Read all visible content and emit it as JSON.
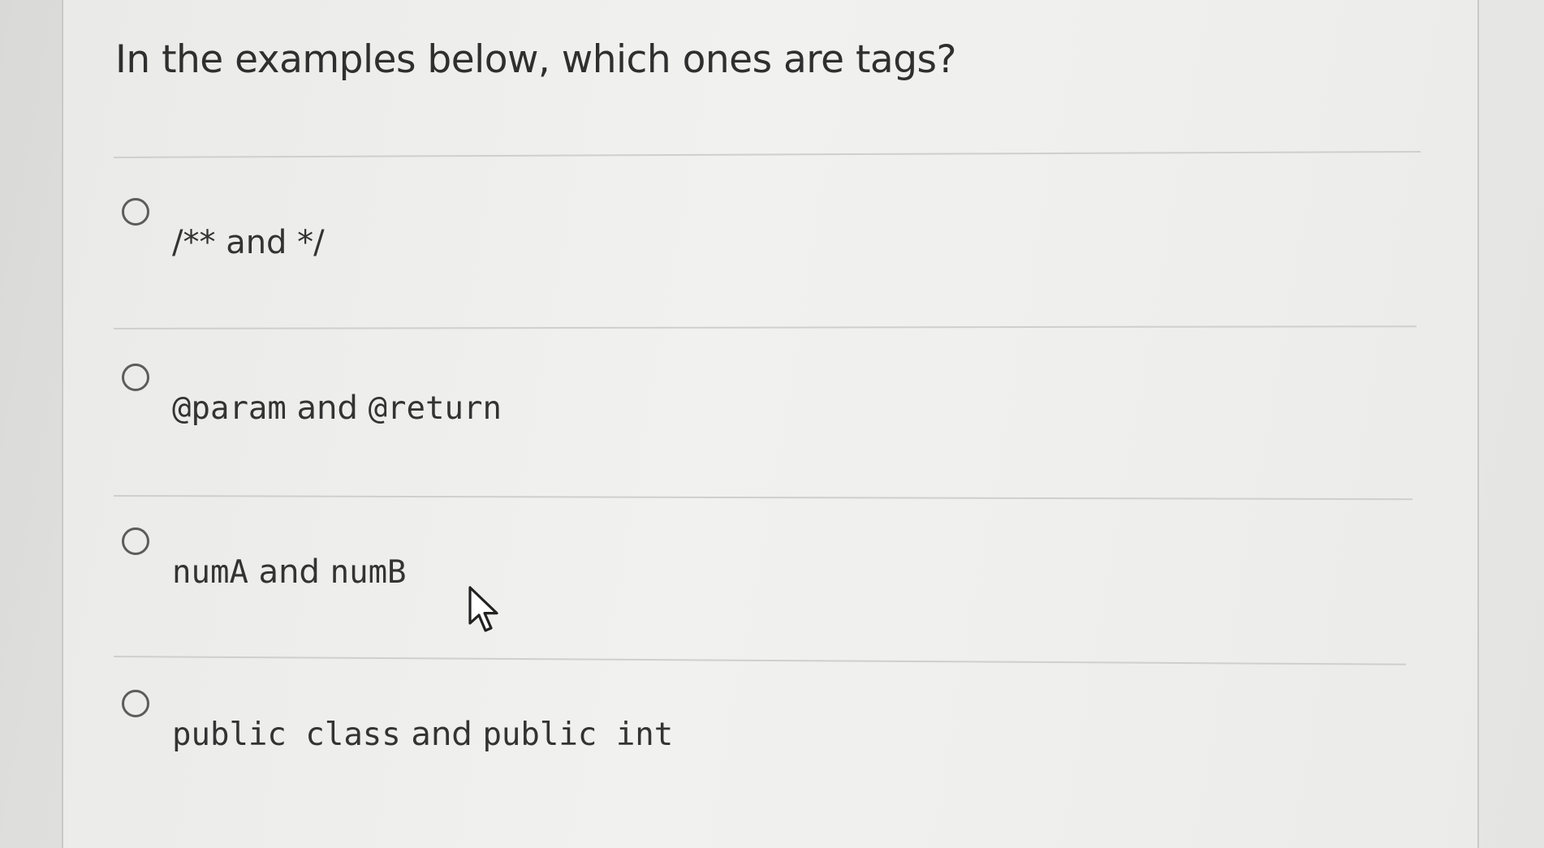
{
  "question": {
    "text": "In the examples below, which ones are tags?"
  },
  "options": [
    {
      "parts": [
        {
          "text": "/** and */",
          "style": "plain"
        }
      ]
    },
    {
      "parts": [
        {
          "text": "@param",
          "style": "mono"
        },
        {
          "text": " and ",
          "style": "plain"
        },
        {
          "text": "@return",
          "style": "mono"
        }
      ]
    },
    {
      "parts": [
        {
          "text": "numA",
          "style": "mono"
        },
        {
          "text": " and ",
          "style": "plain"
        },
        {
          "text": "numB",
          "style": "mono"
        }
      ]
    },
    {
      "parts": [
        {
          "text": "public class",
          "style": "mono"
        },
        {
          "text": " and ",
          "style": "plain"
        },
        {
          "text": "public int",
          "style": "mono"
        }
      ]
    }
  ],
  "icons": {
    "radio": "radio-unselected-icon",
    "cursor": "mouse-pointer-icon"
  }
}
